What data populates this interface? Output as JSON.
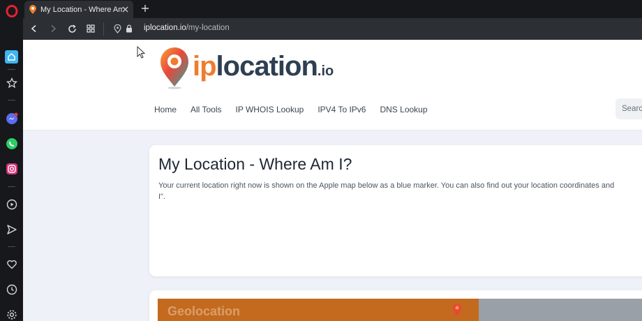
{
  "browser": {
    "tab": {
      "title": "My Location - Where Am I?"
    },
    "new_tab_icon": "plus-icon",
    "toolbar": {
      "url_domain": "iplocation.io",
      "url_path": "/my-location"
    }
  },
  "sidebar": {
    "icons": [
      "opera-logo-icon",
      "home-icon",
      "star-icon",
      "messenger-icon",
      "whatsapp-icon",
      "instagram-icon",
      "player-icon",
      "send-icon",
      "heart-icon",
      "history-icon",
      "settings-icon"
    ]
  },
  "site": {
    "logo": {
      "ip": "ip",
      "rest": "location",
      "tld": ".io"
    },
    "nav": [
      "Home",
      "All Tools",
      "IP WHOIS Lookup",
      "IPV4 To IPv6",
      "DNS Lookup"
    ],
    "search_placeholder": "Search"
  },
  "main": {
    "title": "My Location - Where Am I?",
    "description_line1": "Your current location right now is shown on the Apple map below as a blue marker. You can also find out your location coordinates and",
    "description_line2": "I\"."
  },
  "map_card": {
    "label": "Geolocation"
  },
  "colors": {
    "brand_orange": "#f07c2c",
    "brand_navy": "#2f3f52",
    "browser_dark": "#16181c",
    "toolbar": "#2c2f34"
  }
}
